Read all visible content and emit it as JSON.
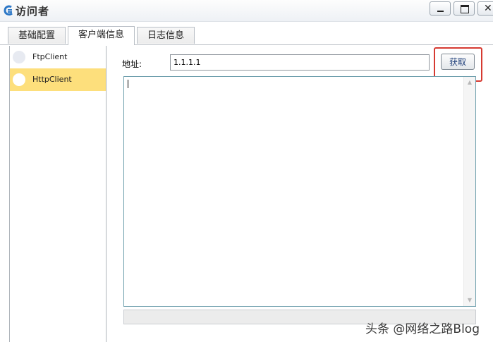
{
  "window": {
    "title": "访问者",
    "icon": "app-logo-icon",
    "controls": {
      "minimize": "minimize-icon",
      "maximize": "maximize-icon",
      "close": "close-icon"
    }
  },
  "tabs": [
    {
      "label": "基础配置",
      "active": false
    },
    {
      "label": "客户端信息",
      "active": true
    },
    {
      "label": "日志信息",
      "active": false
    }
  ],
  "sidebar": {
    "items": [
      {
        "label": "FtpClient",
        "selected": false
      },
      {
        "label": "HttpClient",
        "selected": true
      }
    ]
  },
  "form": {
    "address_label": "地址:",
    "address_value": "1.1.1.1",
    "fetch_label": "获取"
  },
  "output": {
    "text": ""
  },
  "colors": {
    "selected_bg": "#fddf7c",
    "highlight": "#d63a31",
    "output_border": "#6e9fad"
  },
  "watermark": "头条 @网络之路Blog"
}
